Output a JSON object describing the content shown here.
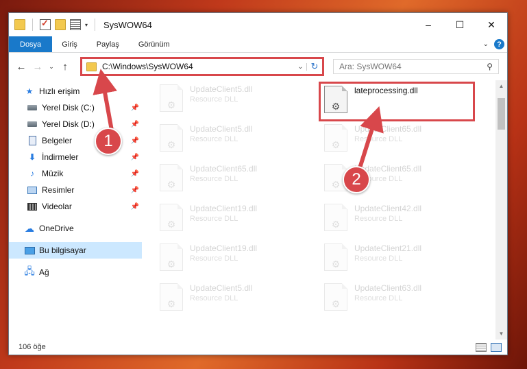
{
  "window": {
    "title": "SysWOW64"
  },
  "quick_access_toolbar": {
    "icons": [
      "folder-icon",
      "properties-check-icon",
      "new-folder-icon",
      "properties-icon",
      "customize-icon"
    ]
  },
  "window_controls": {
    "minimize": "–",
    "maximize": "☐",
    "close": "✕"
  },
  "ribbon": {
    "tabs": [
      {
        "label": "Dosya",
        "active": true
      },
      {
        "label": "Giriş"
      },
      {
        "label": "Paylaş"
      },
      {
        "label": "Görünüm"
      }
    ],
    "help": "?"
  },
  "navigation": {
    "address_path": "C:\\Windows\\SysWOW64",
    "search_placeholder": "Ara: SysWOW64"
  },
  "sidebar": {
    "quick_access": {
      "label": "Hızlı erişim"
    },
    "pinned": [
      {
        "label": "Yerel Disk (C:)",
        "icon": "drive-icon"
      },
      {
        "label": "Yerel Disk (D:)",
        "icon": "drive-icon"
      },
      {
        "label": "Belgeler",
        "icon": "documents-icon"
      },
      {
        "label": "İndirmeler",
        "icon": "downloads-icon"
      },
      {
        "label": "Müzik",
        "icon": "music-icon"
      },
      {
        "label": "Resimler",
        "icon": "pictures-icon"
      },
      {
        "label": "Videolar",
        "icon": "videos-icon"
      }
    ],
    "onedrive": {
      "label": "OneDrive"
    },
    "this_pc": {
      "label": "Bu bilgisayar",
      "selected": true
    },
    "network": {
      "label": "Ağ"
    }
  },
  "files": {
    "highlighted": {
      "name": "lateprocessing.dll",
      "type": ""
    },
    "column1": [
      {
        "name": "UpdateClient5.dll",
        "type": "Resource DLL"
      },
      {
        "name": "UpdateClient5.dll",
        "type": "Resource DLL"
      },
      {
        "name": "UpdateClient65.dll",
        "type": "Resource DLL"
      },
      {
        "name": "UpdateClient19.dll",
        "type": "Resource DLL"
      },
      {
        "name": "UpdateClient19.dll",
        "type": "Resource DLL"
      },
      {
        "name": "UpdateClient5.dll",
        "type": "Resource DLL"
      }
    ],
    "column2": [
      {
        "name": "UpdateClient65.dll",
        "type": "Resource DLL"
      },
      {
        "name": "UpdateClient65.dll",
        "type": "Resource DLL"
      },
      {
        "name": "UpdateClient42.dll",
        "type": "Resource DLL"
      },
      {
        "name": "UpdateClient21.dll",
        "type": "Resource DLL"
      },
      {
        "name": "UpdateClient63.dll",
        "type": "Resource DLL"
      }
    ]
  },
  "status": {
    "item_count": "106 öğe"
  },
  "callouts": {
    "one": "1",
    "two": "2"
  },
  "colors": {
    "accent": "#1979ca",
    "highlight": "#d8474b",
    "selection": "#cce8ff"
  }
}
